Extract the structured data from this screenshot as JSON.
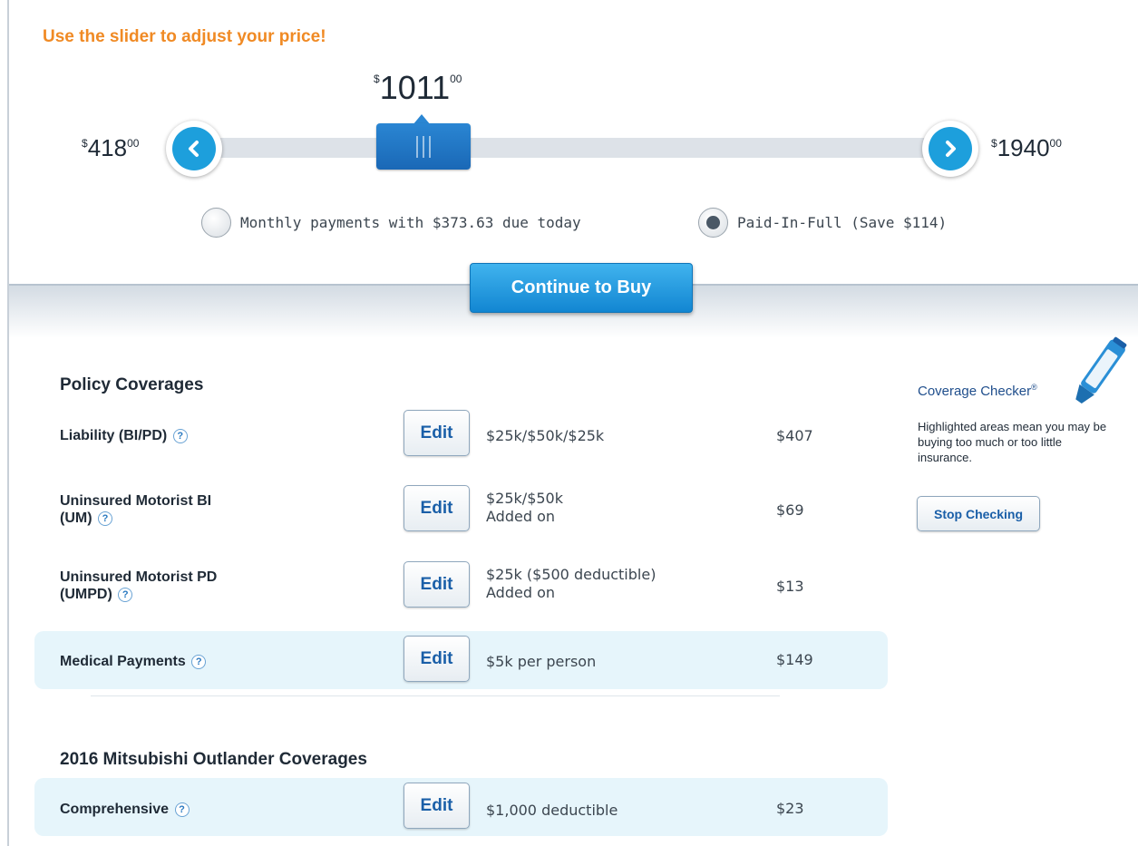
{
  "slider": {
    "title": "Use the slider to adjust your price!",
    "current": {
      "currency": "$",
      "dollars": "1011",
      "cents": "00"
    },
    "min": {
      "currency": "$",
      "dollars": "418",
      "cents": "00"
    },
    "max": {
      "currency": "$",
      "dollars": "1940",
      "cents": "00"
    },
    "position_fraction": 0.39
  },
  "payment_options": {
    "monthly": {
      "label": "Monthly payments with $373.63 due today",
      "selected": false
    },
    "paid_in_full": {
      "label": "Paid-In-Full (Save $114)",
      "selected": true
    }
  },
  "cta": {
    "label": "Continue to Buy"
  },
  "policy_coverages": {
    "title": "Policy Coverages",
    "items": [
      {
        "label": "Liability (BI/PD)",
        "value_line1": "$25k/$50k/$25k",
        "value_line2": "",
        "price": "$407",
        "highlighted": false
      },
      {
        "label": "Uninsured Motorist BI",
        "label_line2": "(UM)",
        "value_line1": "$25k/$50k",
        "value_line2": "Added on",
        "price": "$69",
        "highlighted": false
      },
      {
        "label": "Uninsured Motorist PD",
        "label_line2": "(UMPD)",
        "value_line1": "$25k ($500 deductible)",
        "value_line2": "Added on",
        "price": "$13",
        "highlighted": false
      },
      {
        "label": "Medical Payments",
        "value_line1": "$5k per person",
        "value_line2": "",
        "price": "$149",
        "highlighted": true
      }
    ]
  },
  "vehicle_coverages": {
    "title": "2016 Mitsubishi Outlander Coverages",
    "items": [
      {
        "label": "Comprehensive",
        "value_line1": "$1,000 deductible",
        "price": "$23",
        "highlighted": true
      }
    ]
  },
  "edit_label": "Edit",
  "help_glyph": "?",
  "coverage_checker": {
    "title": "Coverage Checker",
    "registered": "®",
    "description": "Highlighted areas mean you may be buying too much or too little insurance.",
    "button": "Stop Checking",
    "icon": "highlighter-marker-icon"
  },
  "colors": {
    "accent_orange": "#f08a24",
    "brand_blue": "#1d9fdc",
    "highlight_row": "#e6f5fb"
  }
}
